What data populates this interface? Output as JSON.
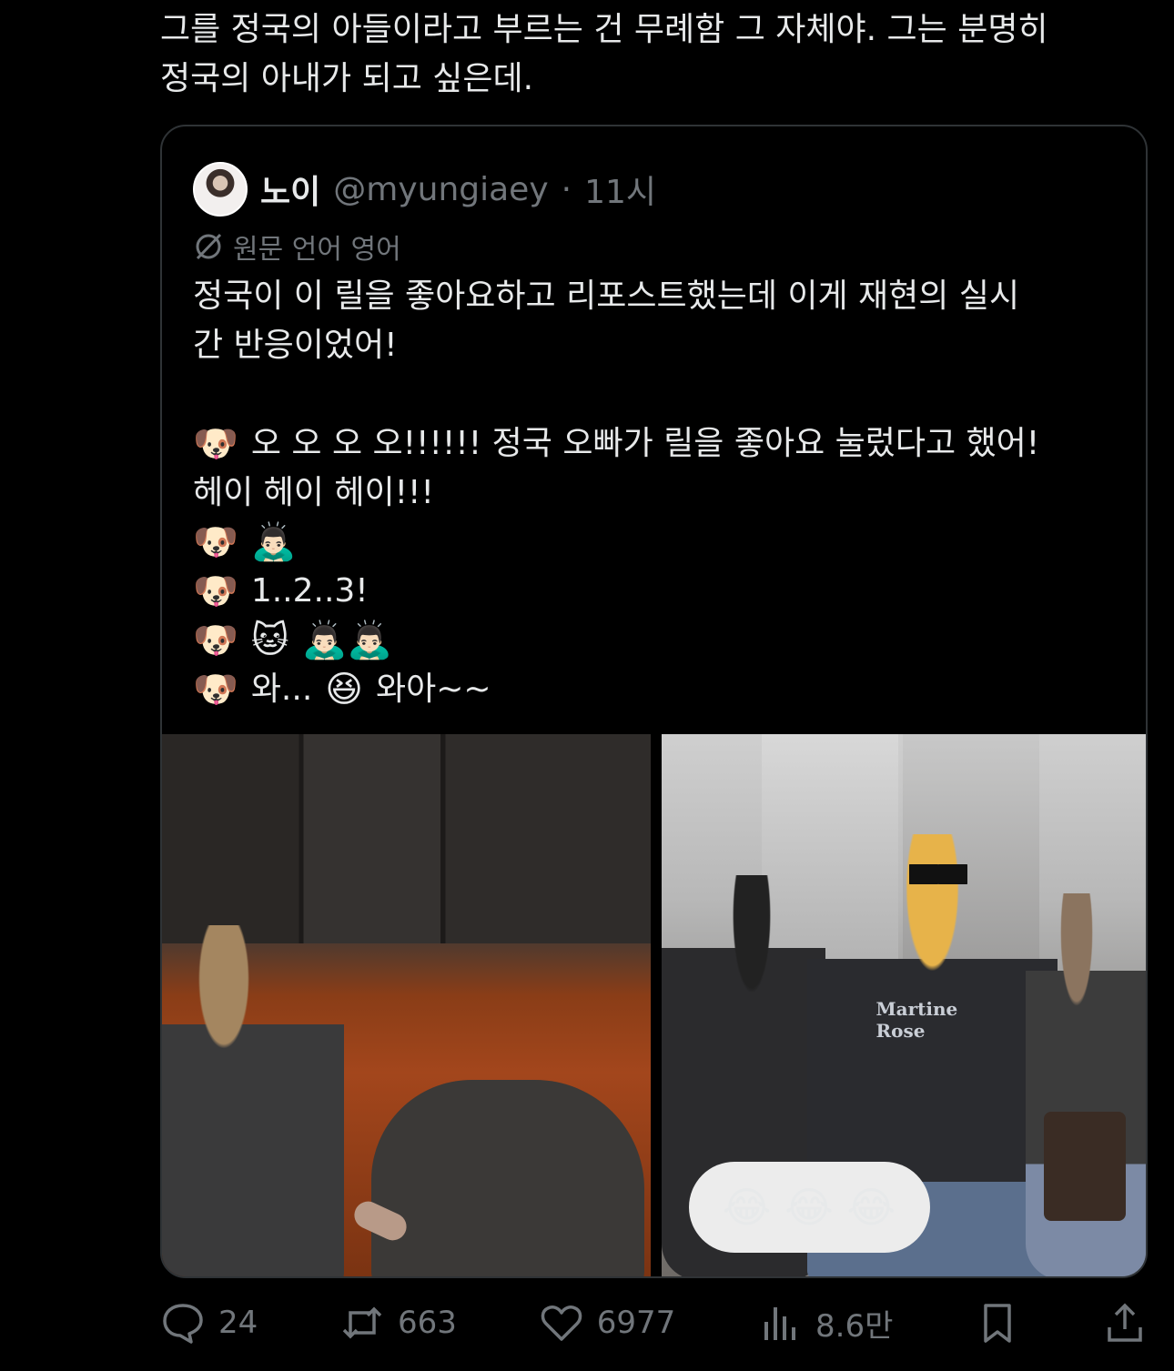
{
  "post": {
    "text_line1": "그를 정국의 아들이라고 부르는 건 무례함 그 자체야. 그는 분명히",
    "text_line2": "정국의 아내가 되고 싶은데."
  },
  "quote": {
    "name": "노이",
    "handle": "@myungiaey",
    "separator": "·",
    "time": "11시",
    "translation_label": "원문 언어 영어",
    "body": {
      "line1": "정국이 이 릴을 좋아요하고 리포스트했는데 이게 재현의 실시",
      "line2": "간 반응이었어!",
      "line3_emoji": "🐶",
      "line3_text": "오 오 오 오!!!!!! 정국 오빠가 릴을 좋아요 눌렀다고 했어!",
      "line4": "헤이 헤이 헤이!!!",
      "line5_emoji1": "🐶",
      "line5_emoji2": "🙇🏻‍♂️",
      "line6_emoji": "🐶",
      "line6_text": "1..2..3!",
      "line7_emoji1": "🐶",
      "line7_emoji2": "🐱",
      "line7_emoji3": "🙇🏻‍♂️🙇🏻‍♂️",
      "line8_emoji1": "🐶",
      "line8_text1": "와...",
      "line8_emoji2": "😆",
      "line8_text2": "와아~~"
    },
    "media": {
      "right_overlay_emojis": "😂 😂 😂",
      "right_jacket_text": "Martine Rose"
    }
  },
  "actions": {
    "replies": "24",
    "reposts": "663",
    "likes": "6977",
    "views": "8.6만"
  },
  "colors": {
    "background": "#000000",
    "text_primary": "#e7e9ea",
    "text_secondary": "#71767b",
    "border": "#2f3336"
  },
  "icons": {
    "reply": "speech-bubble-icon",
    "repost": "repost-arrows-icon",
    "like": "heart-icon",
    "views": "bar-chart-icon",
    "bookmark": "bookmark-icon",
    "share": "share-upload-icon",
    "translate": "globe-slash-icon"
  }
}
